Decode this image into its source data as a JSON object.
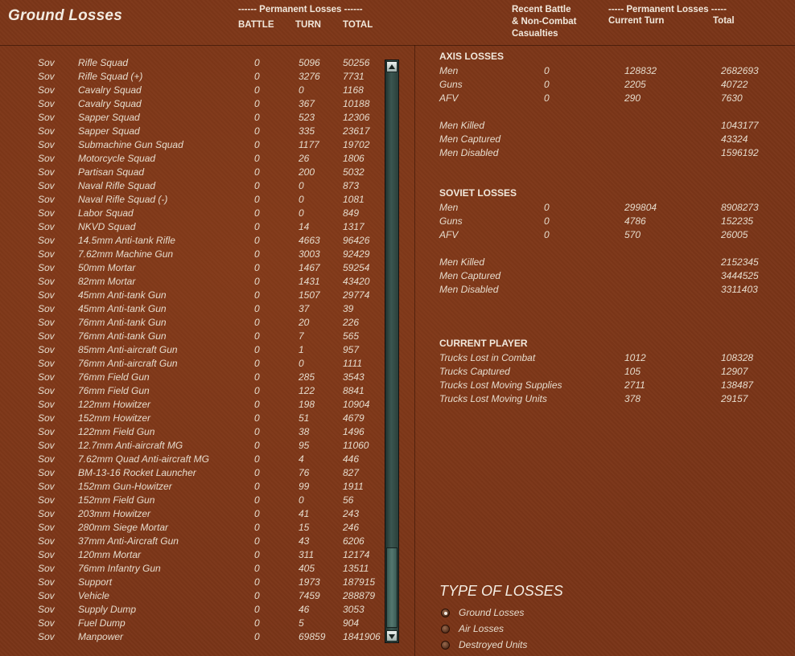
{
  "title": "Ground Losses",
  "left_header": {
    "group": "------ Permanent Losses ------",
    "battle": "BATTLE",
    "turn": "TURN",
    "total": "TOTAL"
  },
  "right_header": {
    "recent": [
      "Recent Battle",
      "& Non-Combat",
      "Casualties"
    ],
    "group": "----- Permanent Losses -----",
    "current": "Current Turn",
    "total": "Total"
  },
  "units": [
    {
      "nat": "Sov",
      "name": "Rifle Squad",
      "battle": "0",
      "turn": "5096",
      "total": "50256"
    },
    {
      "nat": "Sov",
      "name": "Rifle Squad (+)",
      "battle": "0",
      "turn": "3276",
      "total": "7731"
    },
    {
      "nat": "Sov",
      "name": "Cavalry Squad",
      "battle": "0",
      "turn": "0",
      "total": "1168"
    },
    {
      "nat": "Sov",
      "name": "Cavalry Squad",
      "battle": "0",
      "turn": "367",
      "total": "10188"
    },
    {
      "nat": "Sov",
      "name": "Sapper Squad",
      "battle": "0",
      "turn": "523",
      "total": "12306"
    },
    {
      "nat": "Sov",
      "name": "Sapper Squad",
      "battle": "0",
      "turn": "335",
      "total": "23617"
    },
    {
      "nat": "Sov",
      "name": "Submachine Gun Squad",
      "battle": "0",
      "turn": "1177",
      "total": "19702"
    },
    {
      "nat": "Sov",
      "name": "Motorcycle Squad",
      "battle": "0",
      "turn": "26",
      "total": "1806"
    },
    {
      "nat": "Sov",
      "name": "Partisan Squad",
      "battle": "0",
      "turn": "200",
      "total": "5032"
    },
    {
      "nat": "Sov",
      "name": "Naval Rifle Squad",
      "battle": "0",
      "turn": "0",
      "total": "873"
    },
    {
      "nat": "Sov",
      "name": "Naval Rifle Squad (-)",
      "battle": "0",
      "turn": "0",
      "total": "1081"
    },
    {
      "nat": "Sov",
      "name": "Labor Squad",
      "battle": "0",
      "turn": "0",
      "total": "849"
    },
    {
      "nat": "Sov",
      "name": "NKVD Squad",
      "battle": "0",
      "turn": "14",
      "total": "1317"
    },
    {
      "nat": "Sov",
      "name": "14.5mm Anti-tank Rifle",
      "battle": "0",
      "turn": "4663",
      "total": "96426"
    },
    {
      "nat": "Sov",
      "name": "7.62mm Machine Gun",
      "battle": "0",
      "turn": "3003",
      "total": "92429"
    },
    {
      "nat": "Sov",
      "name": "50mm Mortar",
      "battle": "0",
      "turn": "1467",
      "total": "59254"
    },
    {
      "nat": "Sov",
      "name": "82mm Mortar",
      "battle": "0",
      "turn": "1431",
      "total": "43420"
    },
    {
      "nat": "Sov",
      "name": "45mm Anti-tank Gun",
      "battle": "0",
      "turn": "1507",
      "total": "29774"
    },
    {
      "nat": "Sov",
      "name": "45mm Anti-tank Gun",
      "battle": "0",
      "turn": "37",
      "total": "39"
    },
    {
      "nat": "Sov",
      "name": "76mm Anti-tank Gun",
      "battle": "0",
      "turn": "20",
      "total": "226"
    },
    {
      "nat": "Sov",
      "name": "76mm Anti-tank Gun",
      "battle": "0",
      "turn": "7",
      "total": "565"
    },
    {
      "nat": "Sov",
      "name": "85mm Anti-aircraft Gun",
      "battle": "0",
      "turn": "1",
      "total": "957"
    },
    {
      "nat": "Sov",
      "name": "76mm Anti-aircraft Gun",
      "battle": "0",
      "turn": "0",
      "total": "1111"
    },
    {
      "nat": "Sov",
      "name": "76mm Field Gun",
      "battle": "0",
      "turn": "285",
      "total": "3543"
    },
    {
      "nat": "Sov",
      "name": "76mm Field Gun",
      "battle": "0",
      "turn": "122",
      "total": "8841"
    },
    {
      "nat": "Sov",
      "name": "122mm Howitzer",
      "battle": "0",
      "turn": "198",
      "total": "10904"
    },
    {
      "nat": "Sov",
      "name": "152mm Howitzer",
      "battle": "0",
      "turn": "51",
      "total": "4679"
    },
    {
      "nat": "Sov",
      "name": "122mm Field Gun",
      "battle": "0",
      "turn": "38",
      "total": "1496"
    },
    {
      "nat": "Sov",
      "name": "12.7mm Anti-aircraft MG",
      "battle": "0",
      "turn": "95",
      "total": "11060"
    },
    {
      "nat": "Sov",
      "name": "7.62mm Quad Anti-aircraft MG",
      "battle": "0",
      "turn": "4",
      "total": "446"
    },
    {
      "nat": "Sov",
      "name": "BM-13-16 Rocket Launcher",
      "battle": "0",
      "turn": "76",
      "total": "827"
    },
    {
      "nat": "Sov",
      "name": "152mm Gun-Howitzer",
      "battle": "0",
      "turn": "99",
      "total": "1911"
    },
    {
      "nat": "Sov",
      "name": "152mm Field Gun",
      "battle": "0",
      "turn": "0",
      "total": "56"
    },
    {
      "nat": "Sov",
      "name": "203mm Howitzer",
      "battle": "0",
      "turn": "41",
      "total": "243"
    },
    {
      "nat": "Sov",
      "name": "280mm Siege Mortar",
      "battle": "0",
      "turn": "15",
      "total": "246"
    },
    {
      "nat": "Sov",
      "name": "37mm Anti-Aircraft Gun",
      "battle": "0",
      "turn": "43",
      "total": "6206"
    },
    {
      "nat": "Sov",
      "name": "120mm Mortar",
      "battle": "0",
      "turn": "311",
      "total": "12174"
    },
    {
      "nat": "Sov",
      "name": "76mm Infantry Gun",
      "battle": "0",
      "turn": "405",
      "total": "13511"
    },
    {
      "nat": "Sov",
      "name": "Support",
      "battle": "0",
      "turn": "1973",
      "total": "187915"
    },
    {
      "nat": "Sov",
      "name": "Vehicle",
      "battle": "0",
      "turn": "7459",
      "total": "288879"
    },
    {
      "nat": "Sov",
      "name": "Supply Dump",
      "battle": "0",
      "turn": "46",
      "total": "3053"
    },
    {
      "nat": "Sov",
      "name": "Fuel Dump",
      "battle": "0",
      "turn": "5",
      "total": "904"
    },
    {
      "nat": "Sov",
      "name": "Manpower",
      "battle": "0",
      "turn": "69859",
      "total": "1841906"
    }
  ],
  "axis": {
    "title": "AXIS LOSSES",
    "rows": [
      {
        "label": "Men",
        "recent": "0",
        "current": "128832",
        "total": "2682693"
      },
      {
        "label": "Guns",
        "recent": "0",
        "current": "2205",
        "total": "40722"
      },
      {
        "label": "AFV",
        "recent": "0",
        "current": "290",
        "total": "7630"
      }
    ],
    "detail": [
      {
        "label": "Men Killed",
        "total": "1043177"
      },
      {
        "label": "Men Captured",
        "total": "43324"
      },
      {
        "label": "Men Disabled",
        "total": "1596192"
      }
    ]
  },
  "soviet": {
    "title": "SOVIET LOSSES",
    "rows": [
      {
        "label": "Men",
        "recent": "0",
        "current": "299804",
        "total": "8908273"
      },
      {
        "label": "Guns",
        "recent": "0",
        "current": "4786",
        "total": "152235"
      },
      {
        "label": "AFV",
        "recent": "0",
        "current": "570",
        "total": "26005"
      }
    ],
    "detail": [
      {
        "label": "Men Killed",
        "total": "2152345"
      },
      {
        "label": "Men Captured",
        "total": "3444525"
      },
      {
        "label": "Men Disabled",
        "total": "3311403"
      }
    ]
  },
  "current_player": {
    "title": "CURRENT PLAYER",
    "rows": [
      {
        "label": "Trucks Lost in Combat",
        "current": "1012",
        "total": "108328"
      },
      {
        "label": "Trucks Captured",
        "current": "105",
        "total": "12907"
      },
      {
        "label": "Trucks Lost Moving Supplies",
        "current": "2711",
        "total": "138487"
      },
      {
        "label": "Trucks Lost Moving Units",
        "current": "378",
        "total": "29157"
      }
    ]
  },
  "type_of_losses": {
    "title": "TYPE OF LOSSES",
    "options": [
      {
        "label": "Ground Losses",
        "selected": true
      },
      {
        "label": "Air Losses",
        "selected": false
      },
      {
        "label": "Destroyed Units",
        "selected": false
      }
    ]
  }
}
